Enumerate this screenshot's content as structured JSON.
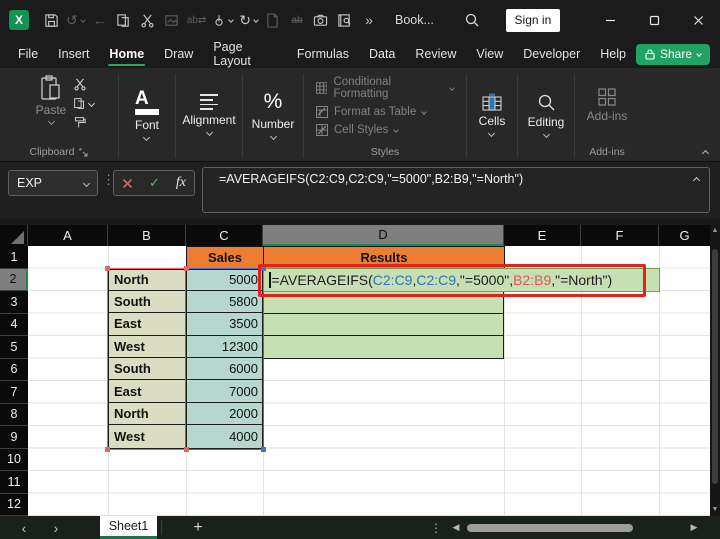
{
  "titlebar": {
    "doc_title": "Book...",
    "sign_in": "Sign in",
    "overflow_glyph": "»"
  },
  "tabs": {
    "labels": [
      "File",
      "Insert",
      "Home",
      "Draw",
      "Page Layout",
      "Formulas",
      "Data",
      "Review",
      "View",
      "Developer",
      "Help"
    ],
    "active": "Home",
    "share_label": "Share"
  },
  "ribbon": {
    "paste_label": "Paste",
    "font_label": "Font",
    "alignment_label": "Alignment",
    "number_label": "Number",
    "conditional_formatting_label": "Conditional Formatting",
    "format_as_table_label": "Format as Table",
    "cell_styles_label": "Cell Styles",
    "cells_label": "Cells",
    "editing_label": "Editing",
    "addins_label": "Add-ins",
    "group_clipboard": "Clipboard",
    "group_styles": "Styles",
    "group_addins": "Add-ins"
  },
  "formula_bar": {
    "name_box": "EXP",
    "fx_label": "fx",
    "formula": "=AVERAGEIFS(C2:C9,C2:C9,\"=5000\",B2:B9,\"=North\")"
  },
  "sheet": {
    "col_headers": [
      "A",
      "B",
      "C",
      "D",
      "E",
      "F",
      "G"
    ],
    "row_numbers": [
      "1",
      "2",
      "3",
      "4",
      "5",
      "6",
      "7",
      "8",
      "9",
      "10",
      "11",
      "12"
    ],
    "selected_column": "D",
    "selected_row": "2",
    "sales_header": "Sales",
    "results_header": "Results",
    "rows": [
      {
        "region": "North",
        "sales": "5000"
      },
      {
        "region": "South",
        "sales": "5800"
      },
      {
        "region": "East",
        "sales": "3500"
      },
      {
        "region": "West",
        "sales": "12300"
      },
      {
        "region": "South",
        "sales": "6000"
      },
      {
        "region": "East",
        "sales": "7000"
      },
      {
        "region": "North",
        "sales": "2000"
      },
      {
        "region": "West",
        "sales": "4000"
      }
    ],
    "formula_segments": [
      {
        "text": "=AVERAGEIFS(",
        "color": "#1b1b1b"
      },
      {
        "text": "C2:C9",
        "color": "#2e75b6"
      },
      {
        "text": ",",
        "color": "#1b1b1b"
      },
      {
        "text": "C2:C9",
        "color": "#2e75b6"
      },
      {
        "text": ",\"=5000\",",
        "color": "#1b1b1b"
      },
      {
        "text": "B2:B9",
        "color": "#e15759"
      },
      {
        "text": ",\"=North\")",
        "color": "#1b1b1b"
      }
    ]
  },
  "sheet_bar": {
    "tab": "Sheet1",
    "add_label": "+"
  },
  "colors": {
    "accent_green": "#21a366",
    "header_orange": "#ed7d31",
    "region_fill": "#daddc2",
    "sales_fill": "#b6d7ce",
    "result_fill": "#c6e0b4",
    "ref_red": "#e0696b",
    "ref_blue": "#4472c4",
    "annotation_red": "#e2231a"
  }
}
